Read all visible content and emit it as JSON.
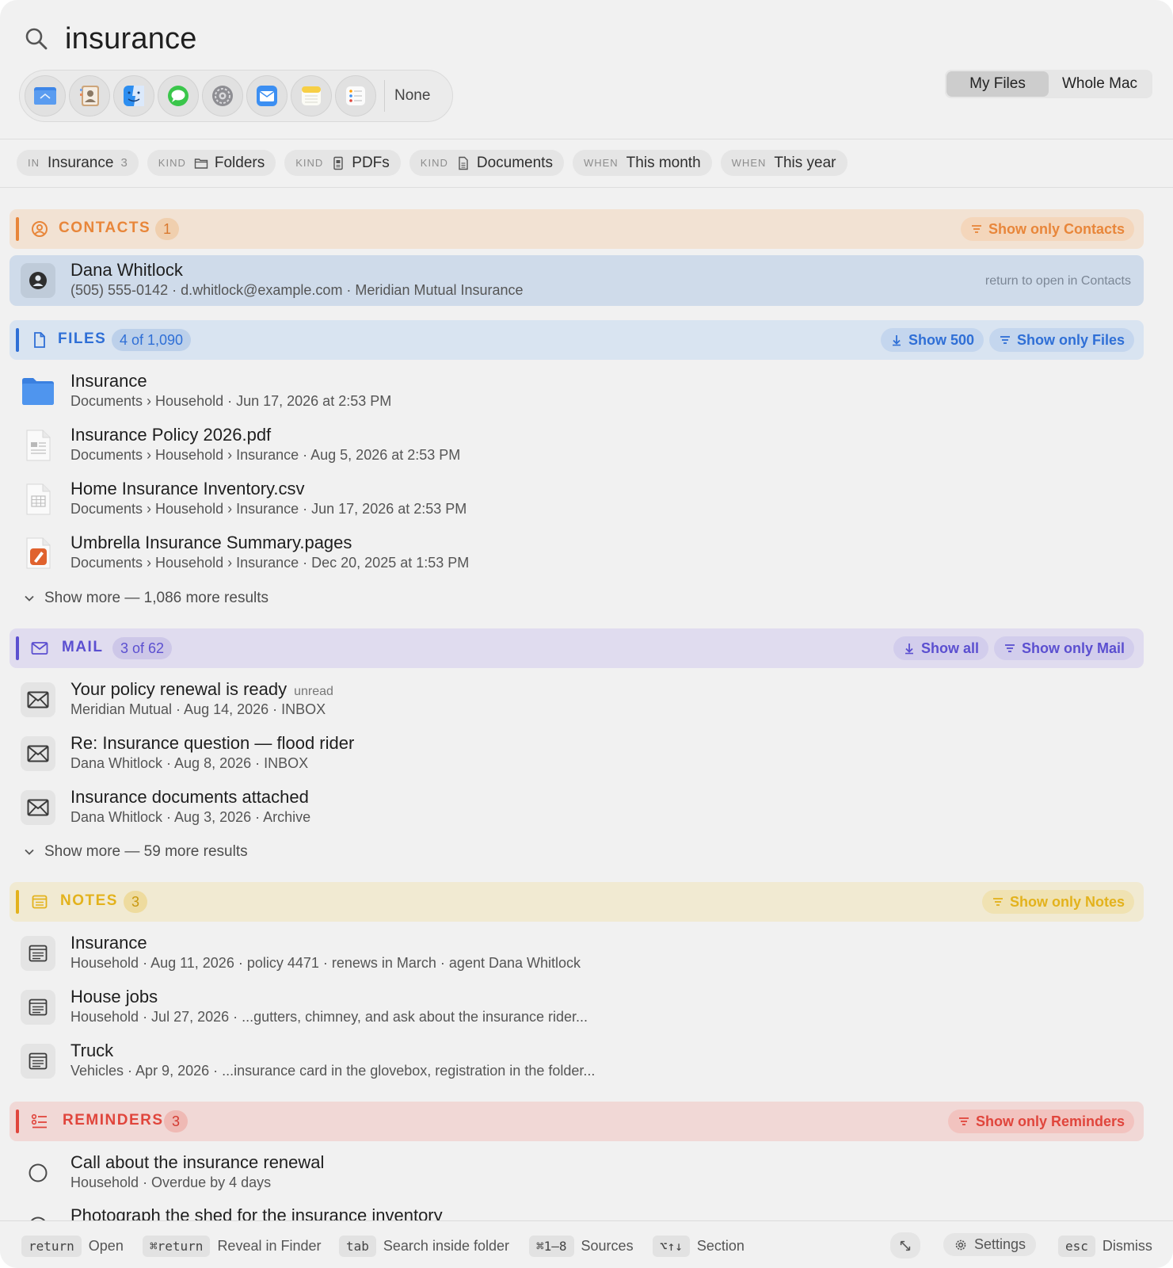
{
  "search": {
    "query": "insurance"
  },
  "apps": {
    "items": [
      {
        "name": "Files"
      },
      {
        "name": "Contacts"
      },
      {
        "name": "Finder"
      },
      {
        "name": "Messages"
      },
      {
        "name": "System Settings"
      },
      {
        "name": "Mail"
      },
      {
        "name": "Notes"
      },
      {
        "name": "Reminders"
      }
    ],
    "none_label": "None"
  },
  "scope": {
    "my_files": "My Files",
    "whole_mac": "Whole Mac",
    "selected": "My Files"
  },
  "chips": [
    {
      "kind": "IN",
      "label": "Insurance",
      "count": "3"
    },
    {
      "kind": "KIND",
      "label": "Folders",
      "icon": "folder-icon"
    },
    {
      "kind": "KIND",
      "label": "PDFs",
      "icon": "pdf-icon"
    },
    {
      "kind": "KIND",
      "label": "Documents",
      "icon": "document-icon"
    },
    {
      "kind": "WHEN",
      "label": "This month"
    },
    {
      "kind": "WHEN",
      "label": "This year"
    }
  ],
  "contacts": {
    "title": "CONTACTS",
    "count": "1",
    "filter_label": "Show only Contacts",
    "color": "#e8863a",
    "items": [
      {
        "name": "Dana Whitlock",
        "detail": "(505) 555-0142 · d.whitlock@example.com · Meridian Mutual Insurance",
        "hint": "return to open in Contacts"
      }
    ]
  },
  "files": {
    "title": "FILES",
    "count": "4 of 1,090",
    "show_label": "Show 500",
    "filter_label": "Show only Files",
    "color": "#2f6fd6",
    "items": [
      {
        "name": "Insurance",
        "detail": "Documents › Household · Jun 17, 2026 at 2:53 PM",
        "icon": "folder-icon"
      },
      {
        "name": "Insurance Policy 2026.pdf",
        "detail": "Documents › Household › Insurance · Aug 5, 2026 at 2:53 PM",
        "icon": "pdf-file-icon"
      },
      {
        "name": "Home Insurance Inventory.csv",
        "detail": "Documents › Household › Insurance · Jun 17, 2026 at 2:53 PM",
        "icon": "csv-file-icon"
      },
      {
        "name": "Umbrella Insurance Summary.pages",
        "detail": "Documents › Household › Insurance · Dec 20, 2025 at 1:53 PM",
        "icon": "pages-file-icon"
      }
    ],
    "more_label": "Show more — 1,086 more results"
  },
  "mail": {
    "title": "MAIL",
    "count": "3 of 62",
    "show_label": "Show all",
    "filter_label": "Show only Mail",
    "color": "#5b4fd0",
    "items": [
      {
        "subject": "Your policy renewal is ready",
        "tag": "unread",
        "detail": "Meridian Mutual · Aug 14, 2026 · INBOX"
      },
      {
        "subject": "Re: Insurance question — flood rider",
        "tag": "",
        "detail": "Dana Whitlock · Aug 8, 2026 · INBOX"
      },
      {
        "subject": "Insurance documents attached",
        "tag": "",
        "detail": "Dana Whitlock · Aug 3, 2026 · Archive"
      }
    ],
    "more_label": "Show more — 59 more results"
  },
  "notes": {
    "title": "NOTES",
    "count": "3",
    "filter_label": "Show only Notes",
    "color": "#e3b21c",
    "items": [
      {
        "title": "Insurance",
        "detail": "Household · Aug 11, 2026 · policy 4471 · renews in March · agent Dana Whitlock"
      },
      {
        "title": "House jobs",
        "detail": "Household · Jul 27, 2026 · ...gutters, chimney, and ask about the insurance rider..."
      },
      {
        "title": "Truck",
        "detail": "Vehicles · Apr 9, 2026 · ...insurance card in the glovebox, registration in the folder..."
      }
    ]
  },
  "reminders": {
    "title": "REMINDERS",
    "count": "3",
    "filter_label": "Show only Reminders",
    "color": "#e0453c",
    "items": [
      {
        "title": "Call about the insurance renewal",
        "detail": "Household · Overdue by 4 days"
      },
      {
        "title": "Photograph the shed for the insurance inventory",
        "detail": ""
      }
    ]
  },
  "footer": {
    "open_key": "return",
    "open_label": "Open",
    "reveal_key": "⌘return",
    "reveal_label": "Reveal in Finder",
    "tab_key": "tab",
    "tab_label": "Search inside folder",
    "sources_key": "⌘1–8",
    "sources_label": "Sources",
    "section_key": "⌥↑↓",
    "section_label": "Section",
    "settings_label": "Settings",
    "dismiss_key": "esc",
    "dismiss_label": "Dismiss"
  }
}
